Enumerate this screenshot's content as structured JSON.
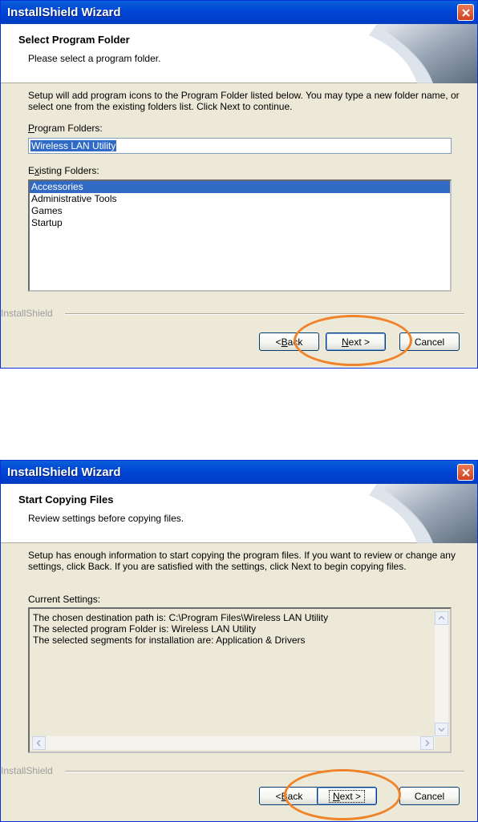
{
  "dialog1": {
    "title": "InstallShield Wizard",
    "header_title": "Select Program Folder",
    "header_subtitle": "Please select a program folder.",
    "description": "Setup will add program icons to the Program Folder listed below.  You may type a new folder name, or select one from the existing folders list.  Click Next to continue.",
    "program_folders_label_underline": "P",
    "program_folders_label_rest": "rogram Folders:",
    "program_folder_value": "Wireless LAN Utility",
    "existing_folders_label_pre": "E",
    "existing_folders_label_underline": "x",
    "existing_folders_label_rest": "isting Folders:",
    "existing_folders": [
      "Accessories",
      "Administrative Tools",
      "Games",
      "Startup"
    ],
    "selected_folder": "Accessories",
    "brand": "InstallShield",
    "back_pre": "< ",
    "back_ul": "B",
    "back_rest": "ack",
    "next_ul": "N",
    "next_rest": "ext >",
    "cancel_label": "Cancel"
  },
  "dialog2": {
    "title": "InstallShield Wizard",
    "header_title": "Start Copying Files",
    "header_subtitle": "Review settings before copying files.",
    "description": "Setup has enough information to start copying the program files.  If you want to review or change any settings, click Back.  If you are satisfied with the settings, click Next to begin copying files.",
    "current_settings_label": "Current Settings:",
    "settings_lines": [
      "The chosen destination path is: C:\\Program Files\\Wireless LAN Utility",
      "The selected program Folder is: Wireless LAN Utility",
      "The selected segments for installation are: Application & Drivers"
    ],
    "brand": "InstallShield",
    "back_pre": "< ",
    "back_ul": "B",
    "back_rest": "ack",
    "next_ul": "N",
    "next_rest": "ext >",
    "cancel_label": "Cancel"
  },
  "colors": {
    "highlight_oval": "#f0822a",
    "selection": "#316ac5",
    "titlebar": "#0046d5"
  },
  "icons": [
    "close-icon",
    "page-curl-graphic",
    "scroll-up-icon",
    "scroll-down-icon",
    "scroll-left-icon",
    "scroll-right-icon"
  ]
}
